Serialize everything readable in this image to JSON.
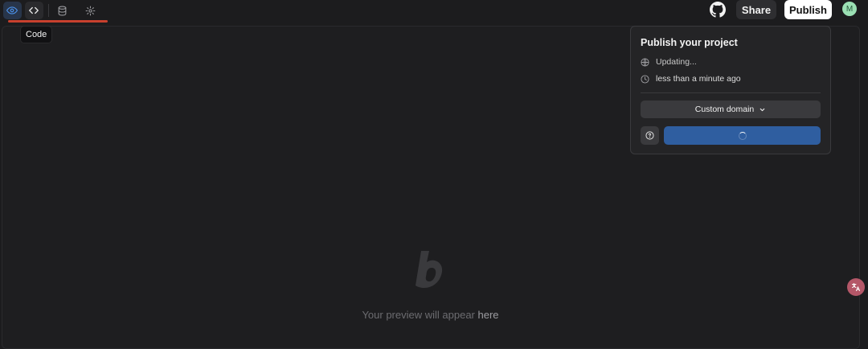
{
  "toolbar": {
    "tools": [
      {
        "name": "preview",
        "icon": "eye-icon"
      },
      {
        "name": "code",
        "icon": "code-icon"
      },
      {
        "name": "database",
        "icon": "database-icon"
      },
      {
        "name": "settings",
        "icon": "gear-icon"
      }
    ],
    "tooltip": "Code",
    "github_icon": "github-icon",
    "share_label": "Share",
    "publish_label": "Publish",
    "avatar_initial": "M",
    "active_color": "#4a8fe7",
    "underline_color": "#c8402e"
  },
  "publish_popover": {
    "title": "Publish your project",
    "status_text": "Updating...",
    "time_text": "less than a minute ago",
    "custom_domain_label": "Custom domain",
    "progress_color": "#2f5ea0"
  },
  "preview": {
    "placeholder_prefix": "Your preview will appear ",
    "placeholder_emphasis": "here"
  },
  "floating": {
    "translate_icon": "translate-icon"
  }
}
